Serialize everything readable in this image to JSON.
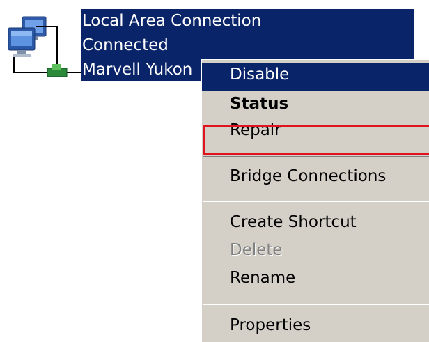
{
  "connection": {
    "name": "Local Area Connection",
    "status": "Connected",
    "device": "Marvell Yukon",
    "icon": "network-connection-icon"
  },
  "context_menu": {
    "items": [
      {
        "label": "Disable",
        "state": "highlighted"
      },
      {
        "label": "Status",
        "state": "default"
      },
      {
        "label": "Repair",
        "state": "normal"
      },
      {
        "label": "Bridge Connections",
        "state": "normal"
      },
      {
        "label": "Create Shortcut",
        "state": "normal"
      },
      {
        "label": "Delete",
        "state": "disabled"
      },
      {
        "label": "Rename",
        "state": "normal"
      },
      {
        "label": "Properties",
        "state": "normal"
      }
    ],
    "highlight_color": "#0a246a",
    "background_color": "#d4d0c8"
  },
  "annotation": {
    "target": "Repair",
    "color": "#e0141e"
  }
}
